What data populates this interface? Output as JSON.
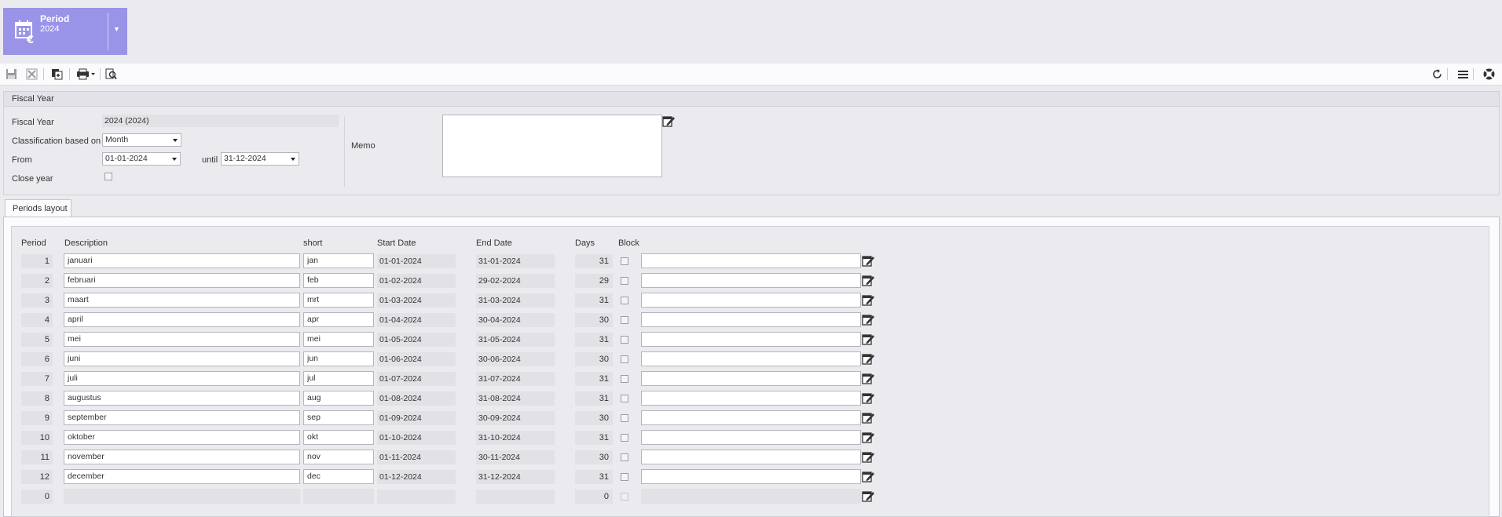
{
  "period_tile": {
    "title": "Period",
    "year": "2024"
  },
  "toolbar": {
    "left_icons": [
      "save-icon",
      "delete-icon",
      "copy-icon",
      "print-icon",
      "preview-icon"
    ],
    "right_icons": [
      "refresh-icon",
      "menu-icon",
      "help-icon"
    ]
  },
  "fiscal": {
    "section_title": "Fiscal Year",
    "fiscal_year_label": "Fiscal Year",
    "fiscal_year_value": "2024 (2024)",
    "classification_label": "Classification based on",
    "classification_value": "Month",
    "from_label": "From",
    "from_value": "01-01-2024",
    "until_label": "until",
    "until_value": "31-12-2024",
    "close_year_label": "Close year",
    "close_year_checked": false,
    "memo_label": "Memo",
    "memo_value": ""
  },
  "tabs": [
    {
      "label": "Periods layout",
      "active": true
    }
  ],
  "periods": {
    "headers": {
      "period": "Period",
      "description": "Description",
      "short": "short",
      "start": "Start Date",
      "end": "End Date",
      "days": "Days",
      "block": "Block"
    },
    "rows": [
      {
        "period": "1",
        "description": "januari",
        "short": "jan",
        "start": "01-01-2024",
        "end": "31-01-2024",
        "days": "31",
        "memo": ""
      },
      {
        "period": "2",
        "description": "februari",
        "short": "feb",
        "start": "01-02-2024",
        "end": "29-02-2024",
        "days": "29",
        "memo": ""
      },
      {
        "period": "3",
        "description": "maart",
        "short": "mrt",
        "start": "01-03-2024",
        "end": "31-03-2024",
        "days": "31",
        "memo": ""
      },
      {
        "period": "4",
        "description": "april",
        "short": "apr",
        "start": "01-04-2024",
        "end": "30-04-2024",
        "days": "30",
        "memo": ""
      },
      {
        "period": "5",
        "description": "mei",
        "short": "mei",
        "start": "01-05-2024",
        "end": "31-05-2024",
        "days": "31",
        "memo": ""
      },
      {
        "period": "6",
        "description": "juni",
        "short": "jun",
        "start": "01-06-2024",
        "end": "30-06-2024",
        "days": "30",
        "memo": ""
      },
      {
        "period": "7",
        "description": "juli",
        "short": "jul",
        "start": "01-07-2024",
        "end": "31-07-2024",
        "days": "31",
        "memo": ""
      },
      {
        "period": "8",
        "description": "augustus",
        "short": "aug",
        "start": "01-08-2024",
        "end": "31-08-2024",
        "days": "31",
        "memo": ""
      },
      {
        "period": "9",
        "description": "september",
        "short": "sep",
        "start": "01-09-2024",
        "end": "30-09-2024",
        "days": "30",
        "memo": ""
      },
      {
        "period": "10",
        "description": "oktober",
        "short": "okt",
        "start": "01-10-2024",
        "end": "31-10-2024",
        "days": "31",
        "memo": ""
      },
      {
        "period": "11",
        "description": "november",
        "short": "nov",
        "start": "01-11-2024",
        "end": "30-11-2024",
        "days": "30",
        "memo": ""
      },
      {
        "period": "12",
        "description": "december",
        "short": "dec",
        "start": "01-12-2024",
        "end": "31-12-2024",
        "days": "31",
        "memo": ""
      },
      {
        "period": "0",
        "description": "",
        "short": "",
        "start": "",
        "end": "",
        "days": "0",
        "memo": "",
        "disabled": true
      }
    ]
  }
}
